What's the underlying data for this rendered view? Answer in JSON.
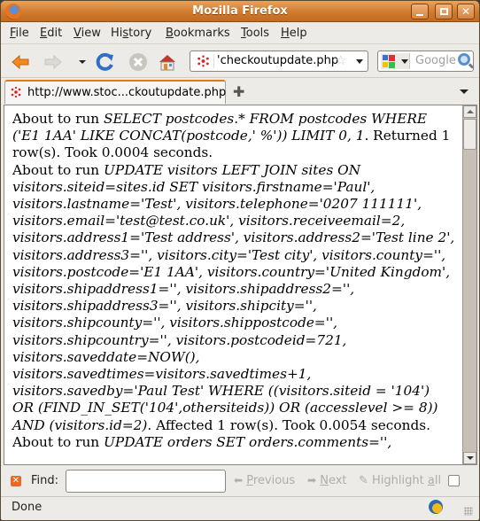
{
  "window": {
    "title": "Mozilla Firefox",
    "controls": [
      "minimize",
      "maximize",
      "close"
    ]
  },
  "menubar": {
    "items": [
      {
        "label": "File",
        "accesskey_index": 0
      },
      {
        "label": "Edit",
        "accesskey_index": 0
      },
      {
        "label": "View",
        "accesskey_index": 0
      },
      {
        "label": "History",
        "accesskey_index": 2
      },
      {
        "label": "Bookmarks",
        "accesskey_index": 0
      },
      {
        "label": "Tools",
        "accesskey_index": 0
      },
      {
        "label": "Help",
        "accesskey_index": 0
      }
    ]
  },
  "navbar": {
    "buttons": [
      "back-icon",
      "forward-icon",
      "history-dropdown-icon",
      "reload-icon",
      "stop-icon",
      "home-icon"
    ],
    "url": "'checkoutupdate.php",
    "search": {
      "engine": "Google",
      "placeholder": "Google"
    }
  },
  "tabs": [
    {
      "label": "http://www.stoc...ckoutupdate.php",
      "active": true
    }
  ],
  "content": {
    "paragraphs": [
      [
        {
          "t": "About to run ",
          "i": false
        },
        {
          "t": "SELECT postcodes.* FROM postcodes WHERE ('E1 1AA' LIKE CONCAT(postcode,' %')) LIMIT 0, 1",
          "i": true
        },
        {
          "t": ". Returned 1 row(s). Took 0.0004 seconds.",
          "i": false
        }
      ],
      [
        {
          "t": "About to run ",
          "i": false
        },
        {
          "t": "UPDATE visitors LEFT JOIN sites ON visitors.siteid=sites.id SET visitors.firstname='Paul', visitors.lastname='Test', visitors.telephone='0207 111111', visitors.email='test@test.co.uk', visitors.receiveemail=2, visitors.address1='Test address', visitors.address2='Test line 2', visitors.address3='', visitors.city='Test city', visitors.county='', visitors.postcode='E1 1AA', visitors.country='United Kingdom', visitors.shipaddress1='', visitors.shipaddress2='', visitors.shipaddress3='', visitors.shipcity='', visitors.shipcounty='', visitors.shippostcode='', visitors.shipcountry='', visitors.postcodeid=721, visitors.saveddate=NOW(), visitors.savedtimes=visitors.savedtimes+1, visitors.savedby='Paul Test' WHERE ((visitors.siteid = '104') OR (FIND_IN_SET('104',othersiteids)) OR (accesslevel >= 8)) AND (visitors.id=2)",
          "i": true
        },
        {
          "t": ". Affected 1 row(s). Took 0.0054 seconds.",
          "i": false
        }
      ],
      [
        {
          "t": "About to run ",
          "i": false
        },
        {
          "t": "UPDATE orders SET orders.comments='',",
          "i": true
        }
      ]
    ]
  },
  "findbar": {
    "label": "Find:",
    "value": "",
    "previous": "Previous",
    "next": "Next",
    "highlight_all": "Highlight all",
    "match_case_checked": false
  },
  "statusbar": {
    "text": "Done"
  },
  "colors": {
    "titlebar_accent": "#d4843e",
    "active_tab_accent": "#e07b1c",
    "find_close": "#e86a2a"
  }
}
